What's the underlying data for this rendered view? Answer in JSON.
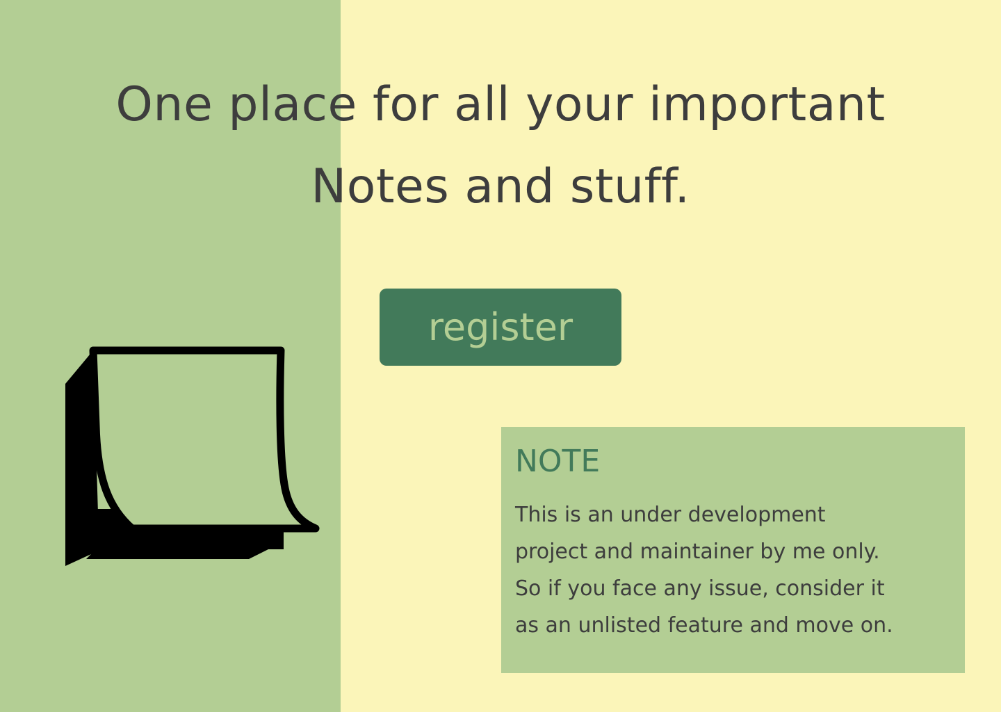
{
  "colors": {
    "background": "#FBF5B9",
    "left_panel": "#B3CE94",
    "accent": "#427A5A",
    "text": "#3D3D3D"
  },
  "hero": {
    "headline_lines": [
      "One place for all your important",
      "Notes and stuff."
    ]
  },
  "actions": {
    "register_label": "register"
  },
  "illustration": {
    "icon": "sticky-note-icon"
  },
  "note": {
    "title": "NOTE",
    "body_lines": [
      "This is an under development",
      "project and maintainer by me only.",
      "So if you face any issue, consider it",
      "as an unlisted  feature and move on."
    ]
  }
}
